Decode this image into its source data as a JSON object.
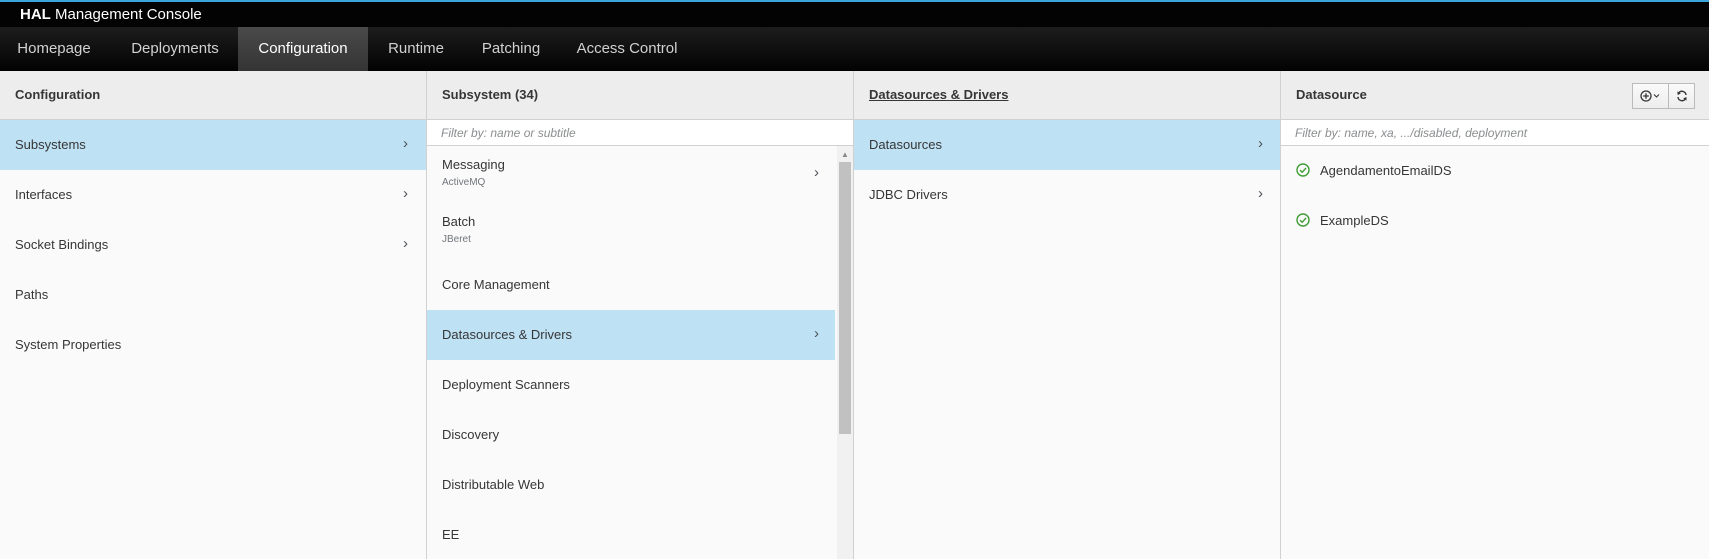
{
  "header": {
    "brand_bold": "HAL",
    "brand_rest": "Management Console"
  },
  "nav": {
    "tabs": [
      {
        "label": "Homepage"
      },
      {
        "label": "Deployments"
      },
      {
        "label": "Configuration",
        "active": true
      },
      {
        "label": "Runtime"
      },
      {
        "label": "Patching"
      },
      {
        "label": "Access Control"
      }
    ]
  },
  "configuration_column": {
    "title": "Configuration",
    "items": [
      {
        "label": "Subsystems",
        "selected": true,
        "has_chevron": true
      },
      {
        "label": "Interfaces",
        "has_chevron": true
      },
      {
        "label": "Socket Bindings",
        "has_chevron": true
      },
      {
        "label": "Paths"
      },
      {
        "label": "System Properties"
      }
    ]
  },
  "subsystem_column": {
    "title": "Subsystem (34)",
    "filter_placeholder": "Filter by: name or subtitle",
    "items": [
      {
        "label": "Messaging",
        "subtitle": "ActiveMQ",
        "has_chevron": true
      },
      {
        "label": "Batch",
        "subtitle": "JBeret"
      },
      {
        "label": "Core Management"
      },
      {
        "label": "Datasources & Drivers",
        "selected": true,
        "has_chevron": true
      },
      {
        "label": "Deployment Scanners"
      },
      {
        "label": "Discovery"
      },
      {
        "label": "Distributable Web"
      },
      {
        "label": "EE"
      }
    ]
  },
  "datasources_drivers_column": {
    "title": "Datasources & Drivers",
    "items": [
      {
        "label": "Datasources",
        "selected": true,
        "has_chevron": true
      },
      {
        "label": "JDBC Drivers",
        "has_chevron": true
      }
    ]
  },
  "datasource_column": {
    "title": "Datasource",
    "filter_placeholder": "Filter by: name, xa, .../disabled, deployment",
    "items": [
      {
        "label": "AgendamentoEmailDS",
        "status": "ok"
      },
      {
        "label": "ExampleDS",
        "status": "ok"
      }
    ],
    "toolbar": {
      "add_icon": "add-circle-icon",
      "refresh_icon": "refresh-icon"
    }
  },
  "colors": {
    "accent": "#39a5dc",
    "selected_row": "#bee1f4",
    "status_ok": "#3f9c35"
  }
}
